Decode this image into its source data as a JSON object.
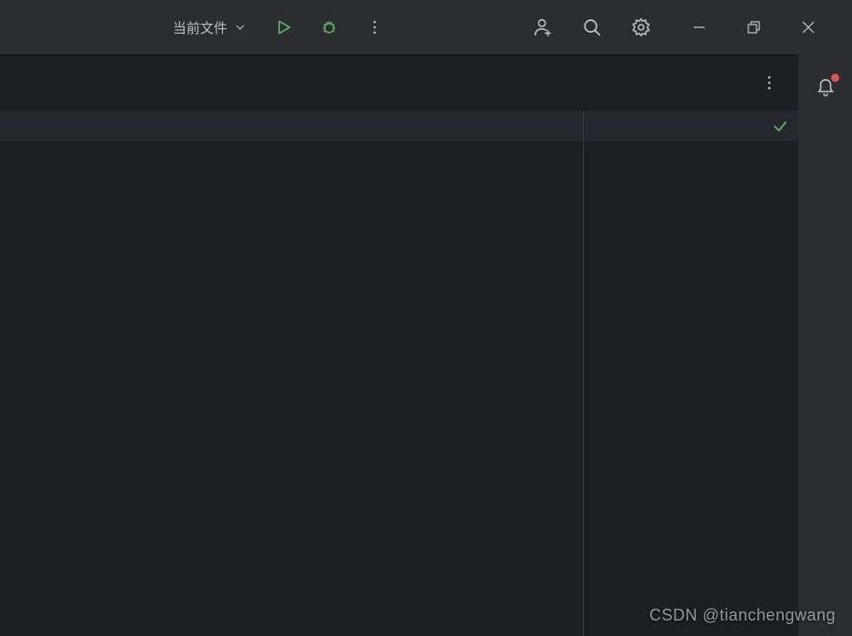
{
  "toolbar": {
    "run_config_label": "当前文件"
  },
  "icons": {
    "run": "run-icon",
    "debug": "debug-icon",
    "more": "more-icon",
    "adduser": "add-user-icon",
    "search": "search-icon",
    "settings": "settings-icon",
    "minimize": "minimize-icon",
    "restore": "restore-icon",
    "close": "close-icon",
    "notification": "notification-icon",
    "check": "check-icon",
    "chevron_down": "chevron-down-icon"
  },
  "colors": {
    "green": "#5ab55a",
    "red_dot": "#e55353",
    "bg_dark": "#1e1f22",
    "bg_mid": "#2b2d30"
  },
  "watermark": "CSDN @tianchengwang"
}
